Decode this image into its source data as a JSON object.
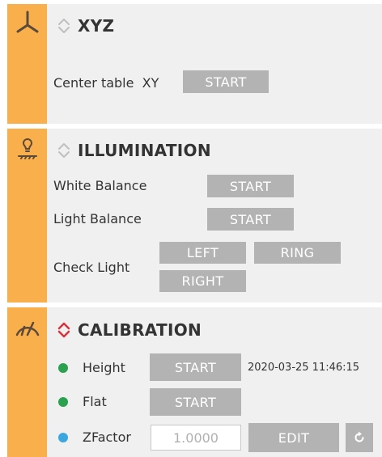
{
  "xyz": {
    "title": "XYZ",
    "center_table_label": "Center table  XY",
    "start_label": "START"
  },
  "illumination": {
    "title": "ILLUMINATION",
    "white_balance_label": "White Balance",
    "white_balance_start": "START",
    "light_balance_label": "Light Balance",
    "light_balance_start": "START",
    "check_light_label": "Check Light",
    "left_label": "LEFT",
    "ring_label": "RING",
    "right_label": "RIGHT"
  },
  "calibration": {
    "title": "CALIBRATION",
    "rows": [
      {
        "label": "Height",
        "button": "START",
        "status_color": "#2aa14f",
        "timestamp": "2020-03-25 11:46:15"
      },
      {
        "label": "Flat",
        "button": "START",
        "status_color": "#2aa14f"
      },
      {
        "label": "ZFactor",
        "status_color": "#3ba7e0",
        "value": "1.0000",
        "button": "EDIT"
      }
    ]
  },
  "colors": {
    "accent_strip": "#f9b04c",
    "panel_bg": "#f0f0f0",
    "button_bg": "#b3b3b3",
    "chevron_inactive": "#bfbfbf",
    "chevron_active": "#d3343c"
  },
  "icons": {
    "xyz": "axes-icon",
    "illumination": "lamp-icon",
    "calibration": "gauge-icon",
    "collapse": "chevron-up-down-icon",
    "reset": "reset-icon"
  }
}
